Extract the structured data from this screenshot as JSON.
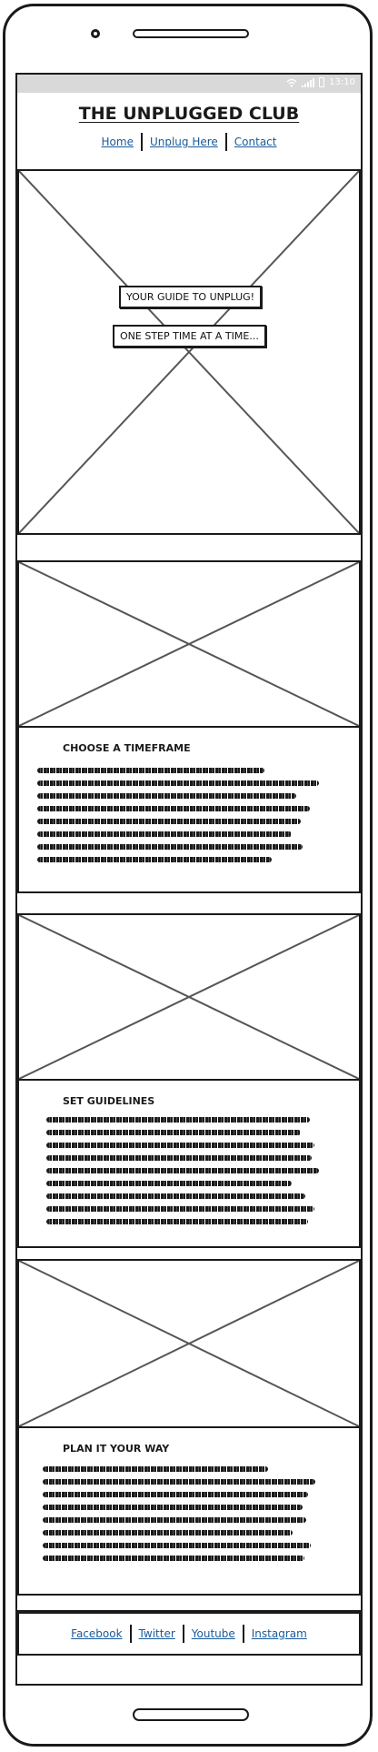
{
  "statusbar": {
    "time": "13:10"
  },
  "header": {
    "title": "THE UNPLUGGED CLUB",
    "nav": [
      "Home",
      "Unplug Here",
      "Contact"
    ]
  },
  "hero": {
    "label_1": "YOUR GUIDE TO UNPLUG!",
    "label_2": "ONE STEP TIME AT A TIME..."
  },
  "sections": [
    {
      "title": "CHOOSE A TIMEFRAME"
    },
    {
      "title": "SET GUIDELINES"
    },
    {
      "title": "PLAN IT YOUR WAY"
    }
  ],
  "footer": {
    "links": [
      "Facebook",
      "Twitter",
      "Youtube",
      "Instagram"
    ]
  },
  "colors": {
    "link": "#1a5a9a",
    "statusbar": "#d9d9d9",
    "ink": "#1a1a1a"
  }
}
